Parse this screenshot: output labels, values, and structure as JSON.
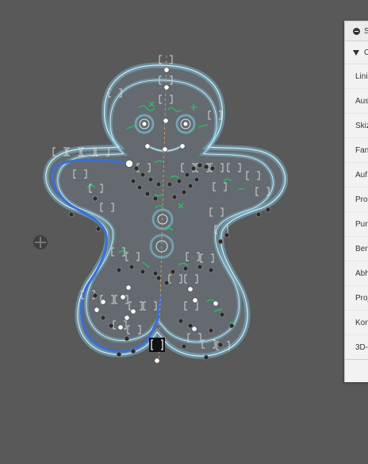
{
  "browser": {
    "header_label": "S",
    "section_label": "C",
    "items": [
      {
        "label": "Lini"
      },
      {
        "label": "Aus"
      },
      {
        "label": "Skiz"
      },
      {
        "label": "Fan"
      },
      {
        "label": "Auf"
      },
      {
        "label": "Pro"
      },
      {
        "label": "Pun"
      },
      {
        "label": "Ben"
      },
      {
        "label": "Abh"
      },
      {
        "label": "Proj"
      },
      {
        "label": "Kon"
      },
      {
        "label": "3D-"
      }
    ]
  },
  "colors": {
    "viewport_bg": "#595959",
    "sketch_body": "#646a6f",
    "outline_glow": "#7ec8e3",
    "outline_line": "#d6eef8",
    "selected_path": "#3b6fd8",
    "constraint_green": "#22c55e",
    "point_white": "#ffffff",
    "point_dark": "#2b2b2b"
  }
}
